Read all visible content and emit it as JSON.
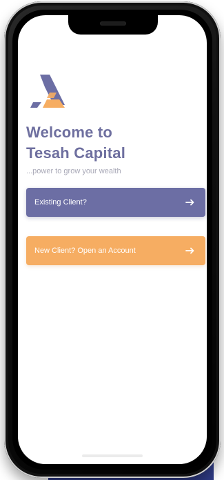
{
  "welcome": {
    "title": "Welcome to\nTesah Capital",
    "tagline": "...power to grow your wealth"
  },
  "buttons": {
    "existing_client": "Existing Client?",
    "new_client": "New Client? Open an Account"
  },
  "icons": {
    "logo": "tesah-capital-logo-icon",
    "arrow": "arrow-right-icon"
  },
  "colors": {
    "primary": "#6c6ea4",
    "accent": "#f6ad62",
    "title": "#6e6f9f",
    "tagline": "#a7a7b6"
  }
}
